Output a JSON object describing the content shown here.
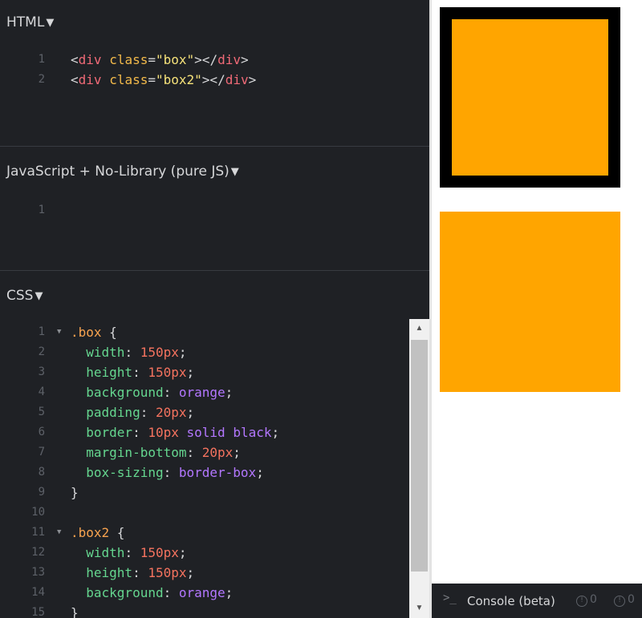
{
  "html_panel": {
    "title": "HTML",
    "lines": [
      {
        "num": "1",
        "tokens": [
          {
            "t": "<",
            "c": "punc"
          },
          {
            "t": "div",
            "c": "tag"
          },
          {
            "t": " ",
            "c": "punc"
          },
          {
            "t": "class",
            "c": "attr"
          },
          {
            "t": "=",
            "c": "punc"
          },
          {
            "t": "\"box\"",
            "c": "str"
          },
          {
            "t": "></",
            "c": "punc"
          },
          {
            "t": "div",
            "c": "tag"
          },
          {
            "t": ">",
            "c": "punc"
          }
        ]
      },
      {
        "num": "2",
        "tokens": [
          {
            "t": "<",
            "c": "punc"
          },
          {
            "t": "div",
            "c": "tag"
          },
          {
            "t": " ",
            "c": "punc"
          },
          {
            "t": "class",
            "c": "attr"
          },
          {
            "t": "=",
            "c": "punc"
          },
          {
            "t": "\"box2\"",
            "c": "str"
          },
          {
            "t": "></",
            "c": "punc"
          },
          {
            "t": "div",
            "c": "tag"
          },
          {
            "t": ">",
            "c": "punc"
          }
        ]
      }
    ]
  },
  "js_panel": {
    "title": "JavaScript + No-Library (pure JS)",
    "lines": [
      {
        "num": "1",
        "tokens": []
      }
    ]
  },
  "css_panel": {
    "title": "CSS",
    "lines": [
      {
        "num": "1",
        "fold": true,
        "tokens": [
          {
            "t": ".box",
            "c": "sel"
          },
          {
            "t": " {",
            "c": "punc"
          }
        ]
      },
      {
        "num": "2",
        "tokens": [
          {
            "t": "  width",
            "c": "prop"
          },
          {
            "t": ": ",
            "c": "punc"
          },
          {
            "t": "150px",
            "c": "num"
          },
          {
            "t": ";",
            "c": "punc"
          }
        ]
      },
      {
        "num": "3",
        "tokens": [
          {
            "t": "  height",
            "c": "prop"
          },
          {
            "t": ": ",
            "c": "punc"
          },
          {
            "t": "150px",
            "c": "num"
          },
          {
            "t": ";",
            "c": "punc"
          }
        ]
      },
      {
        "num": "4",
        "tokens": [
          {
            "t": "  background",
            "c": "prop"
          },
          {
            "t": ": ",
            "c": "punc"
          },
          {
            "t": "orange",
            "c": "kw"
          },
          {
            "t": ";",
            "c": "punc"
          }
        ]
      },
      {
        "num": "5",
        "tokens": [
          {
            "t": "  padding",
            "c": "prop"
          },
          {
            "t": ": ",
            "c": "punc"
          },
          {
            "t": "20px",
            "c": "num"
          },
          {
            "t": ";",
            "c": "punc"
          }
        ]
      },
      {
        "num": "6",
        "tokens": [
          {
            "t": "  border",
            "c": "prop"
          },
          {
            "t": ": ",
            "c": "punc"
          },
          {
            "t": "10px",
            "c": "num"
          },
          {
            "t": " ",
            "c": "punc"
          },
          {
            "t": "solid",
            "c": "kw"
          },
          {
            "t": " ",
            "c": "punc"
          },
          {
            "t": "black",
            "c": "kw"
          },
          {
            "t": ";",
            "c": "punc"
          }
        ]
      },
      {
        "num": "7",
        "tokens": [
          {
            "t": "  margin-bottom",
            "c": "prop"
          },
          {
            "t": ": ",
            "c": "punc"
          },
          {
            "t": "20px",
            "c": "num"
          },
          {
            "t": ";",
            "c": "punc"
          }
        ]
      },
      {
        "num": "8",
        "tokens": [
          {
            "t": "  box-sizing",
            "c": "prop"
          },
          {
            "t": ": ",
            "c": "punc"
          },
          {
            "t": "border-box",
            "c": "kw"
          },
          {
            "t": ";",
            "c": "punc"
          }
        ]
      },
      {
        "num": "9",
        "tokens": [
          {
            "t": "}",
            "c": "punc"
          }
        ]
      },
      {
        "num": "10",
        "tokens": []
      },
      {
        "num": "11",
        "fold": true,
        "tokens": [
          {
            "t": ".box2",
            "c": "sel"
          },
          {
            "t": " {",
            "c": "punc"
          }
        ]
      },
      {
        "num": "12",
        "tokens": [
          {
            "t": "  width",
            "c": "prop"
          },
          {
            "t": ": ",
            "c": "punc"
          },
          {
            "t": "150px",
            "c": "num"
          },
          {
            "t": ";",
            "c": "punc"
          }
        ]
      },
      {
        "num": "13",
        "tokens": [
          {
            "t": "  height",
            "c": "prop"
          },
          {
            "t": ": ",
            "c": "punc"
          },
          {
            "t": "150px",
            "c": "num"
          },
          {
            "t": ";",
            "c": "punc"
          }
        ]
      },
      {
        "num": "14",
        "tokens": [
          {
            "t": "  background",
            "c": "prop"
          },
          {
            "t": ": ",
            "c": "punc"
          },
          {
            "t": "orange",
            "c": "kw"
          },
          {
            "t": ";",
            "c": "punc"
          }
        ]
      },
      {
        "num": "15",
        "tokens": [
          {
            "t": "}",
            "c": "punc"
          }
        ]
      }
    ]
  },
  "preview": {
    "box_background": "#ffa500",
    "box_border_color": "#000000",
    "box2_background": "#ffa500"
  },
  "console": {
    "prompt": ">_",
    "label": "Console (beta)",
    "counters": [
      {
        "icon": "info-icon",
        "value": "0"
      },
      {
        "icon": "info-icon",
        "value": "0"
      }
    ]
  },
  "colors": {
    "editor_bg": "#1f2125",
    "tag": "#f06a77",
    "attr": "#f2b94a",
    "string": "#f6e27a",
    "selector": "#f8a34f",
    "property": "#65d68f",
    "number": "#f5735f",
    "keyword": "#b377ff"
  }
}
